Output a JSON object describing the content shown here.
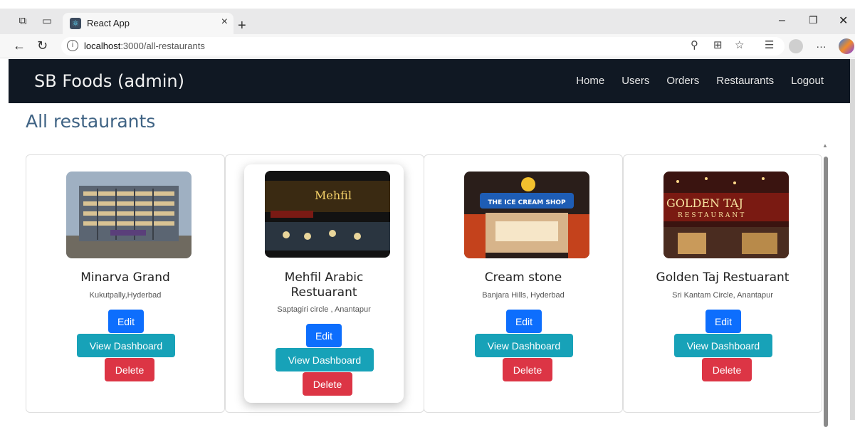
{
  "browser": {
    "tab_title": "React App",
    "url_host": "localhost",
    "url_path": ":3000/all-restaurants"
  },
  "navbar": {
    "brand": "SB Foods (admin)",
    "links": [
      "Home",
      "Users",
      "Orders",
      "Restaurants",
      "Logout"
    ]
  },
  "page": {
    "title": "All restaurants"
  },
  "restaurants": [
    {
      "name": "Minarva Grand",
      "address": "Kukutpally,Hyderbad",
      "edit": "Edit",
      "dashboard": "View Dashboard",
      "delete": "Delete"
    },
    {
      "name": "Mehfil Arabic Restuarant",
      "address": "Saptagiri circle , Anantapur",
      "edit": "Edit",
      "dashboard": "View Dashboard",
      "delete": "Delete"
    },
    {
      "name": "Cream stone",
      "address": "Banjara Hills, Hyderbad",
      "edit": "Edit",
      "dashboard": "View Dashboard",
      "delete": "Delete"
    },
    {
      "name": "Golden Taj Restuarant",
      "address": "Sri Kantam Circle, Anantapur",
      "edit": "Edit",
      "dashboard": "View Dashboard",
      "delete": "Delete"
    }
  ],
  "images": {
    "mehfil_sign": "Mehfil",
    "icecream_sign": "THE ICE CREAM SHOP",
    "golden_sign": "GOLDEN TAJ",
    "golden_sub": "RESTAURANT"
  },
  "colors": {
    "navbar_bg": "#101823",
    "title": "#3f6384",
    "edit": "#0d6efd",
    "dashboard": "#17a2b8",
    "delete": "#dc3545"
  }
}
